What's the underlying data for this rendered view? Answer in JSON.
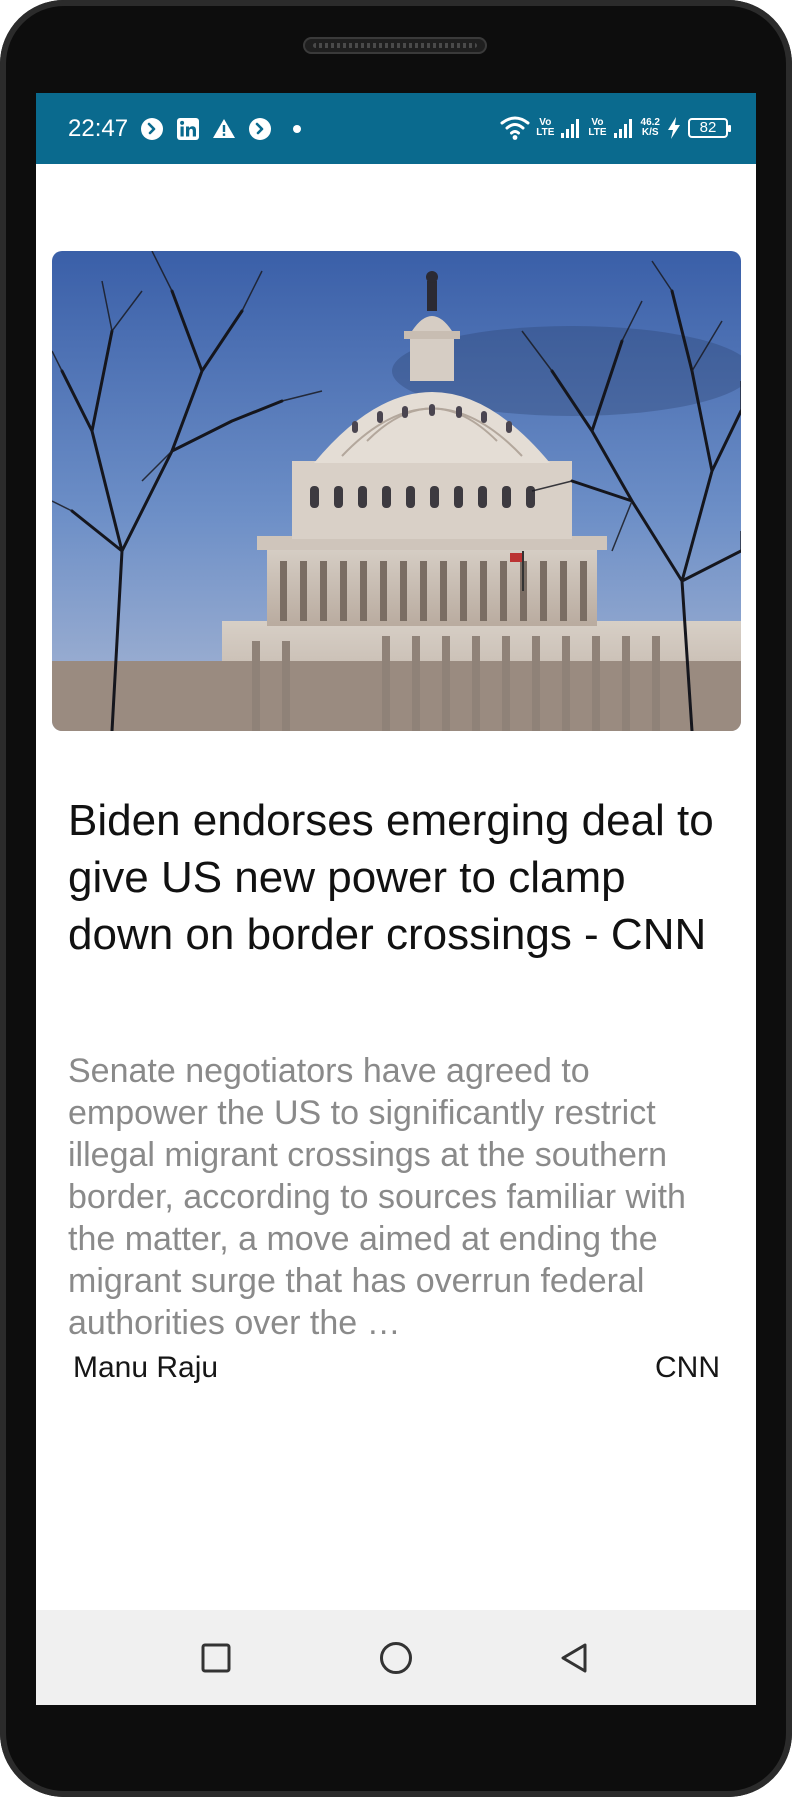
{
  "status_bar": {
    "time": "22:47",
    "left_icons": [
      "shazam-icon",
      "linkedin-icon",
      "alert-icon",
      "shazam-icon",
      "dot-icon"
    ],
    "right_icons": [
      "wifi-icon",
      "volte-icon",
      "signal-icon",
      "volte-icon",
      "signal-icon",
      "net-speed",
      "charging-icon",
      "battery-icon"
    ],
    "volte_label_top": "Vo",
    "volte_label_bottom": "LTE",
    "net_speed_value": "46.2",
    "net_speed_unit": "K/S",
    "battery_level": "82",
    "background_color": "#0a6a8e"
  },
  "article": {
    "headline": "Biden endorses emerging deal to give US new power to clamp down on border crossings - CNN",
    "summary": "Senate negotiators have agreed to empower the US to significantly restrict illegal migrant crossings at the southern border, according to sources familiar with the matter, a move aimed at ending the migrant surge that has overrun federal authorities over the …",
    "author": "Manu Raju",
    "source": "CNN"
  },
  "nav_bar": {
    "buttons": [
      "recents-square-icon",
      "home-circle-icon",
      "back-triangle-icon"
    ]
  }
}
